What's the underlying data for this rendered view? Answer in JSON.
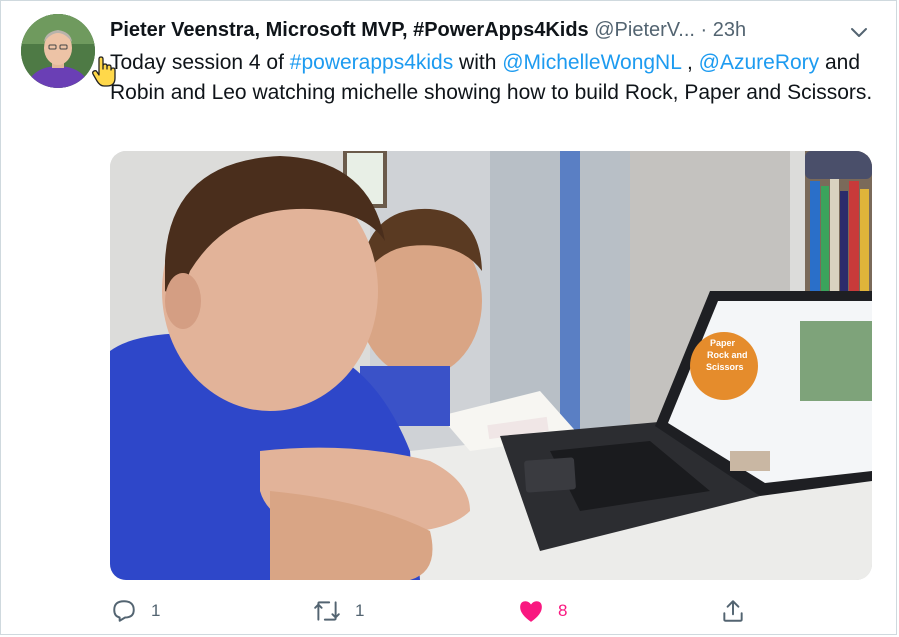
{
  "tweet": {
    "author_name": "Pieter Veenstra, Microsoft MVP, #PowerApps4Kids",
    "handle": "@PieterV...",
    "separator": "·",
    "time": "23h",
    "text": {
      "part1": "Today session 4 of ",
      "hashtag": "#powerapps4kids",
      "part2": " with ",
      "mention1": "@MichelleWongNL",
      "part3": " , ",
      "mention2": "@AzureRory",
      "part4": " and Robin and Leo watching michelle showing how to build Rock, Paper and Scissors."
    },
    "media": {
      "laptop_slide_text": [
        "Paper",
        "Rock and",
        "Scissors"
      ]
    }
  },
  "actions": {
    "reply_count": "1",
    "retweet_count": "1",
    "like_count": "8"
  },
  "colors": {
    "link": "#1d9bf0",
    "like": "#f91880",
    "muted": "#536471"
  },
  "icons": [
    "avatar",
    "chevron-down-icon",
    "hand-cursor-icon",
    "reply-icon",
    "retweet-icon",
    "heart-icon",
    "share-icon"
  ]
}
